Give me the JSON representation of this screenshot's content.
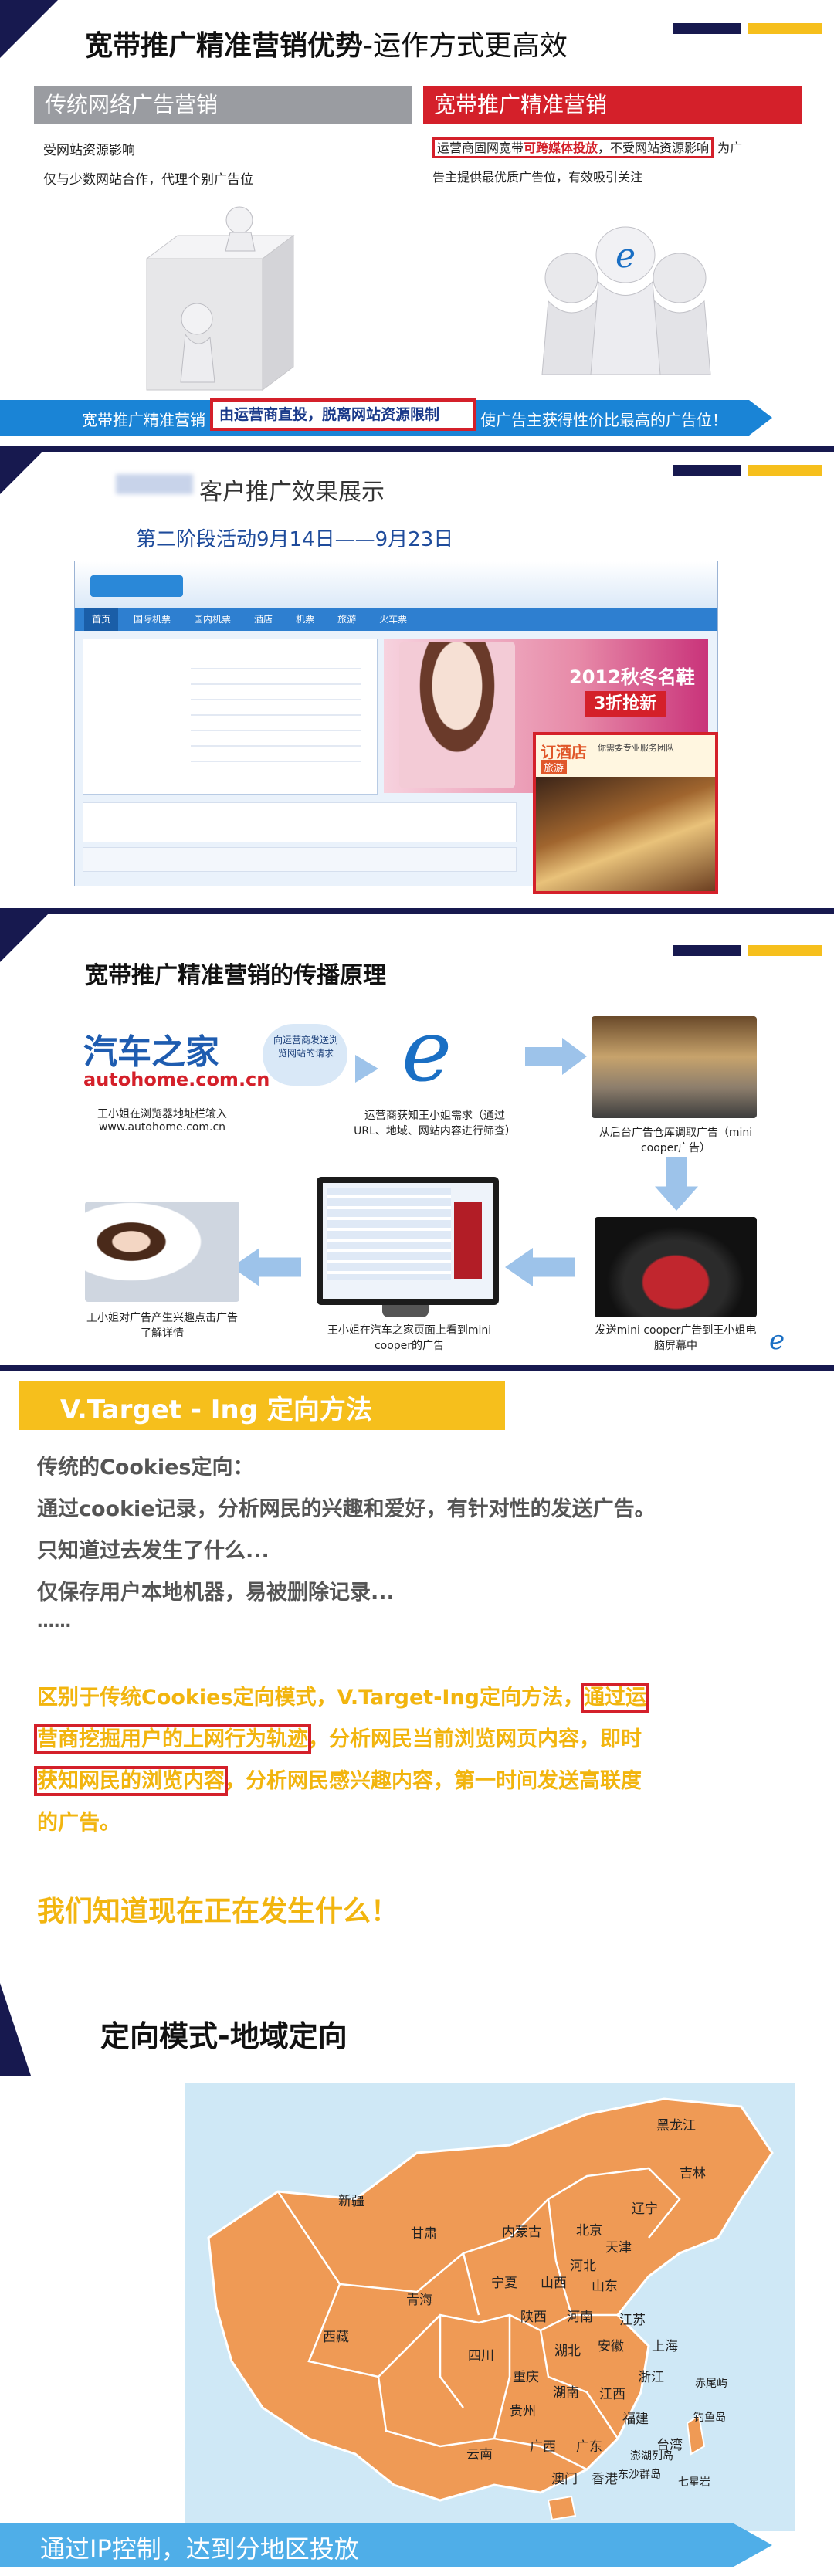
{
  "slide1": {
    "title": "宽带推广精准营销优势",
    "title_suffix": "-运作方式更高效",
    "left_header": "传统网络广告营销",
    "left_line1": "受网站资源影响",
    "left_line2": "仅与少数网站合作，代理个别广告位",
    "right_header": "宽带推广精准营销",
    "right_pre": "运营商固网宽带",
    "right_strong": "可跨媒体投放",
    "right_post": "，不受网站资源影响",
    "right_tail1": "为广",
    "right_tail2": "告主提供最优质广告位，有效吸引关注",
    "banner_pre": "宽带推广精准营销",
    "banner_box": "由运营商直投，脱离网站资源限制",
    "banner_post": "使广告主获得性价比最高的广告位！"
  },
  "slide2": {
    "title": "客户推广效果展示",
    "subtitle": "第二阶段活动9月14日——9月23日",
    "nav_items": [
      "首页",
      "国际机票",
      "国内机票",
      "酒店",
      "机票",
      "旅游",
      "火车票"
    ],
    "promo_main": "2012秋冬名鞋",
    "promo_discount": "3折抢新",
    "ad_title": "订酒店",
    "ad_sub": "你需要专业服务团队",
    "ad_tag": "旅游"
  },
  "slide3": {
    "title": "宽带推广精准营销的传播原理",
    "logo_cn": "汽车之家",
    "logo_en": "autohome.com.cn",
    "step1": "王小姐在浏览器地址栏输入www.autohome.com.cn",
    "bubble": "向运营商发送浏览网站的请求",
    "step2": "运营商获知王小姐需求（通过URL、地域、网站内容进行筛查）",
    "step3": "从后台广告仓库调取广告（mini cooper广告）",
    "step4": "发送mini cooper广告到王小姐电脑屏幕中",
    "step5": "王小姐在汽车之家页面上看到mini cooper的广告",
    "step6": "王小姐对广告产生兴趣点击广告了解详情"
  },
  "slide4": {
    "title": "V.Target - Ing 定向方法",
    "p1": "传统的Cookies定向：",
    "p2": "通过cookie记录，分析网民的兴趣和爱好，有针对性的发送广告。",
    "p3": "只知道过去发生了什么...",
    "p4": "仅保存用户本地机器，易被删除记录...",
    "p5": "……",
    "y1a": "区别于传统Cookies定向模式，V.Target-Ing定向方法，",
    "y1b": "通过运",
    "y2a": "营商挖掘用户的上网行为轨迹",
    "y2b": "，分析网民当前浏览网页内容，即时",
    "y3a": "获知网民的浏览内容",
    "y3b": "，分析网民感兴趣内容，第一时间发送高联度",
    "y4": "的广告。",
    "highlight": "我们知道现在正在发生什么！"
  },
  "slide5": {
    "title": "定向模式-地域定向",
    "footer": "通过IP控制，达到分地区投放",
    "provinces": [
      "黑龙江",
      "吉林",
      "辽宁",
      "新疆",
      "甘肃",
      "内蒙古",
      "北京",
      "天津",
      "河北",
      "宁夏",
      "山西",
      "山东",
      "青海",
      "陕西",
      "河南",
      "江苏",
      "上海",
      "安徽",
      "西藏",
      "四川",
      "湖北",
      "浙江",
      "重庆",
      "湖南",
      "江西",
      "贵州",
      "福建",
      "台湾",
      "云南",
      "广西",
      "广东",
      "澳门",
      "香港",
      "钓鱼岛",
      "赤尾屿",
      "澎湖列岛",
      "东沙群岛",
      "七星岩"
    ]
  },
  "colors": {
    "navy": "#17194f",
    "gold": "#f6bf1c",
    "red": "#d4202a",
    "blue": "#1a6fc4",
    "map_orange": "#ef9a55",
    "sea": "#cfe8f6",
    "yellow_text": "#f2b50f"
  }
}
